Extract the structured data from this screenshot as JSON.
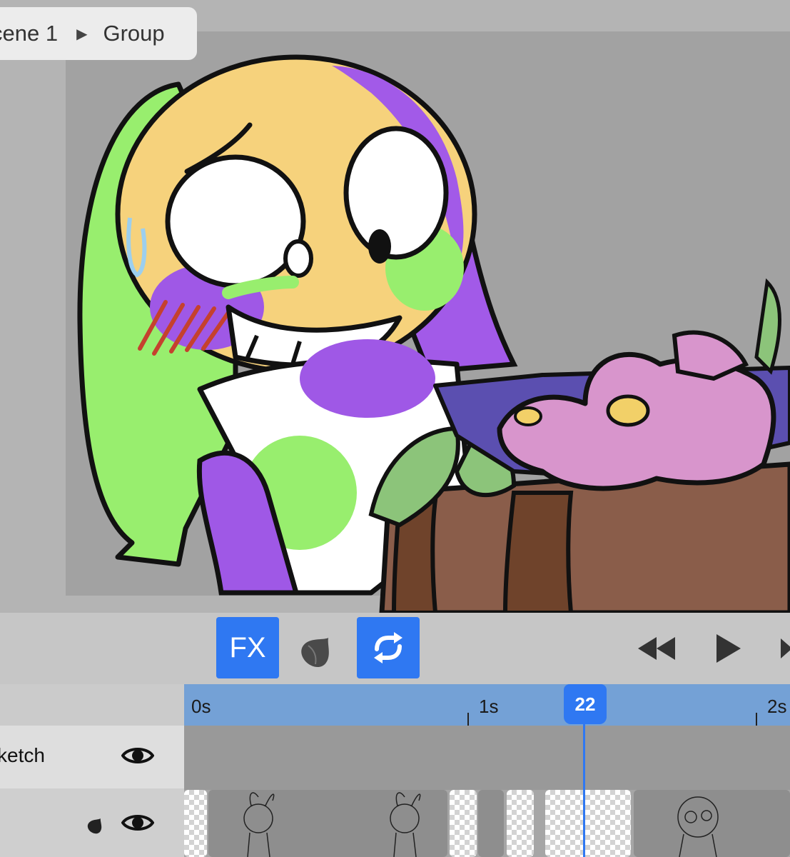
{
  "breadcrumb": {
    "scene": "cene 1",
    "separator": "▶",
    "group": "Group"
  },
  "toolbar": {
    "fx_label": "FX",
    "onion_icon": "onion-skin-icon",
    "loop_icon": "loop-icon",
    "accent_color": "#2f78f2"
  },
  "transport": {
    "rewind_icon": "rewind-icon",
    "play_icon": "play-icon",
    "next_icon": "skip-forward-icon"
  },
  "timeline": {
    "ticks": [
      "0s",
      "1s",
      "2s"
    ],
    "current_frame": "22",
    "ruler_color": "#74a1d6"
  },
  "layers": [
    {
      "name": "ketch",
      "visible": true
    },
    {
      "name": "",
      "visible": true,
      "onion": true
    }
  ]
}
